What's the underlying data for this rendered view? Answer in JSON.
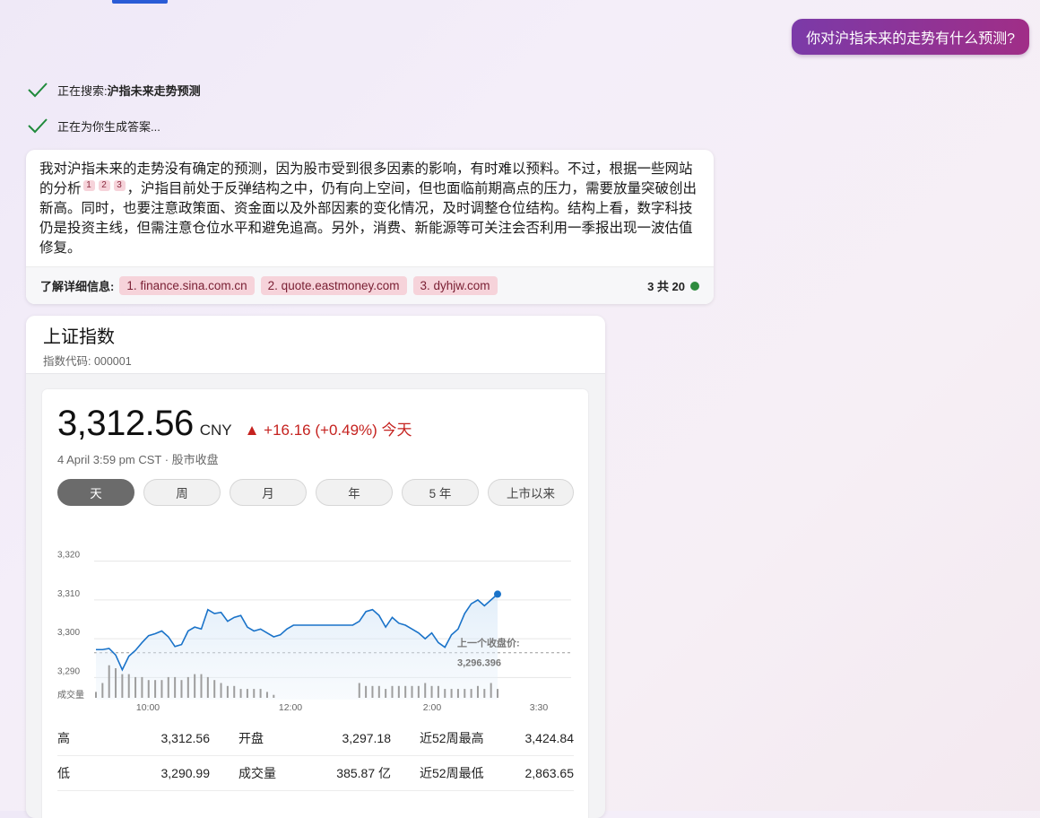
{
  "user_query": "你对沪指未来的走势有什么预测?",
  "steps": [
    {
      "label": "正在搜索: ",
      "bold": "沪指未来走势预测"
    },
    {
      "label": "正在为你生成答案...",
      "bold": ""
    }
  ],
  "answer": {
    "part1": "我对沪指未来的走势没有确定的预测，因为股市受到很多因素的影响，有时难以预料。不过，根据一些网站的分析",
    "citations": [
      "1",
      "2",
      "3"
    ],
    "part2": "，沪指目前处于反弹结构之中，仍有向上空间，但也面临前期高点的压力，需要放量突破创出新高。同时，也要注意政策面、资金面以及外部因素的变化情况，及时调整仓位结构。结构上看，数字科技仍是投资主线，但需注意仓位水平和避免追高。另外，消费、新能源等可关注会否利用一季报出现一波估值修复。"
  },
  "learn_more": {
    "label": "了解详细信息:",
    "sources": [
      "1. finance.sina.com.cn",
      "2. quote.eastmoney.com",
      "3. dyhjw.com"
    ],
    "count": "3 共 20"
  },
  "stock": {
    "name": "上证指数",
    "code": "指数代码: 000001",
    "price": "3,312.56",
    "currency": "CNY",
    "change": "▲ +16.16 (+0.49%) 今天",
    "timestamp": "4 April 3:59 pm CST · 股市收盘",
    "ranges": [
      "天",
      "周",
      "月",
      "年",
      "5 年",
      "上市以来"
    ],
    "active_range": "天"
  },
  "chart_data": {
    "type": "line",
    "x_ticks": [
      "10:00",
      "12:00",
      "2:00",
      "3:30"
    ],
    "y_ticks": [
      "3,320",
      "3,310",
      "3,300",
      "3,290"
    ],
    "ylim": [
      3285,
      3322
    ],
    "volume_label": "成交量",
    "prev_close": 3296.396,
    "prev_close_label": "上一个收盘价:",
    "prev_close_value": "3,296.396",
    "series": [
      {
        "values": [
          3297.2,
          3297.2,
          3297.5,
          3295.8,
          3292.0,
          3295.5,
          3297.0,
          3299.0,
          3300.8,
          3301.3,
          3302.0,
          3300.5,
          3298.0,
          3298.5,
          3302.0,
          3303.0,
          3302.5,
          3307.5,
          3306.5,
          3306.8,
          3304.5,
          3305.5,
          3306.0,
          3303.0,
          3302.0,
          3302.5,
          3301.5,
          3300.5,
          3301.0,
          3302.5,
          3303.5,
          3303.5,
          3303.5,
          3303.5,
          3303.5,
          3303.5,
          3303.5,
          3303.5,
          3303.5,
          3303.5,
          3304.5,
          3307.0,
          3307.5,
          3306.0,
          3303.0,
          3305.5,
          3304.0,
          3303.5,
          3302.5,
          3301.5,
          3300.0,
          3301.5,
          3299.0,
          3297.8,
          3301.0,
          3302.5,
          3306.5,
          3309.0,
          3310.0,
          3308.5,
          3310.0,
          3311.5
        ]
      }
    ],
    "volume": [
      2,
      5,
      11,
      10,
      8,
      8,
      7,
      7,
      6,
      6,
      6,
      7,
      7,
      6,
      7,
      8,
      8,
      7,
      6,
      5,
      4,
      4,
      3,
      3,
      3,
      3,
      2,
      1,
      0,
      0,
      0,
      0,
      0,
      0,
      0,
      0,
      0,
      0,
      0,
      0,
      5,
      4,
      4,
      4,
      3,
      4,
      4,
      4,
      4,
      4,
      5,
      4,
      4,
      3,
      3,
      3,
      3,
      3,
      4,
      3,
      5,
      3
    ]
  },
  "stats": [
    {
      "k1": "高",
      "v1": "3,312.56",
      "k2": "开盘",
      "v2": "3,297.18",
      "k3": "近52周最高",
      "v3": "3,424.84"
    },
    {
      "k1": "低",
      "v1": "3,290.99",
      "k2": "成交量",
      "v2": "385.87 亿",
      "k3": "近52周最低",
      "v3": "2,863.65"
    }
  ]
}
